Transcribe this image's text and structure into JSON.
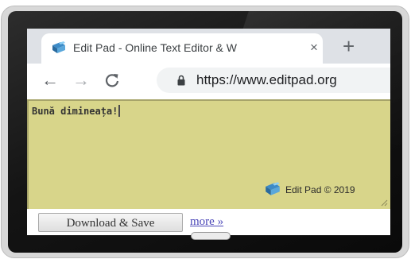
{
  "browser": {
    "tab": {
      "title": "Edit Pad - Online Text Editor & W",
      "close_glyph": "×",
      "favicon": "editpad-logo-icon"
    },
    "new_tab_glyph": "+",
    "nav": {
      "back_glyph": "←",
      "forward_glyph": "→",
      "reload_glyph": "C"
    },
    "address_bar": {
      "url": "https://www.editpad.org",
      "lock": "lock-icon"
    }
  },
  "editor": {
    "content": "Bună dimineața!",
    "background_color": "#d8d58a",
    "watermark": {
      "text": "Edit Pad © 2019",
      "icon": "editpad-logo-icon"
    }
  },
  "actions": {
    "download_label": "Download & Save",
    "more_label": "more »",
    "link_color": "#4a46b8"
  }
}
